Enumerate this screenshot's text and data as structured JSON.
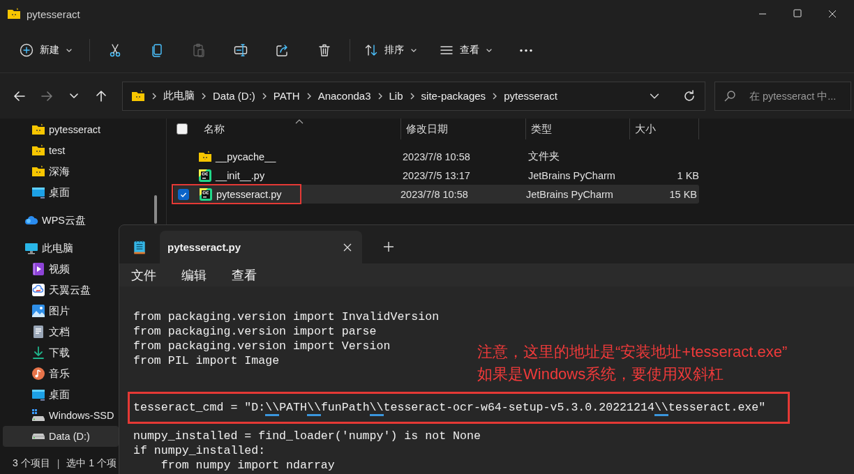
{
  "window": {
    "title": "pytesseract"
  },
  "toolbar": {
    "groups": [
      [
        {
          "kind": "new",
          "label": "新建",
          "disabled": false
        }
      ],
      [
        {
          "kind": "cut",
          "disabled": false
        },
        {
          "kind": "copy",
          "disabled": false
        },
        {
          "kind": "paste",
          "disabled": true
        },
        {
          "kind": "rename",
          "disabled": false
        },
        {
          "kind": "share",
          "disabled": false
        },
        {
          "kind": "delete",
          "disabled": false
        }
      ],
      [
        {
          "kind": "sort",
          "label": "排序",
          "disabled": false
        },
        {
          "kind": "view",
          "label": "查看",
          "disabled": false
        },
        {
          "kind": "more",
          "disabled": false
        }
      ]
    ]
  },
  "nav": [
    {
      "kind": "back",
      "disabled": false
    },
    {
      "kind": "forward",
      "disabled": true
    },
    {
      "kind": "recent",
      "disabled": false
    },
    {
      "kind": "up",
      "disabled": false
    }
  ],
  "address": {
    "crumbs": [
      "此电脑",
      "Data (D:)",
      "PATH",
      "Anaconda3",
      "Lib",
      "site-packages",
      "pytesseract"
    ]
  },
  "search": {
    "placeholder": "在 pytesseract 中..."
  },
  "sidebar": {
    "pinned": [
      {
        "label": "pytesseract",
        "kind": "folder",
        "selected": false
      },
      {
        "label": "test",
        "kind": "folder",
        "selected": false
      },
      {
        "label": "深海",
        "kind": "folder",
        "selected": false
      },
      {
        "label": "桌面",
        "kind": "desktop",
        "selected": false
      }
    ],
    "items": [
      {
        "label": "WPS云盘",
        "kind": "cloud",
        "selected": false
      },
      {
        "label": "此电脑",
        "kind": "computer",
        "selected": false,
        "children": [
          {
            "label": "视频",
            "kind": "video",
            "selected": false
          },
          {
            "label": "天翼云盘",
            "kind": "cloud-drive",
            "selected": false
          },
          {
            "label": "图片",
            "kind": "pictures",
            "selected": false
          },
          {
            "label": "文档",
            "kind": "documents",
            "selected": false
          },
          {
            "label": "下载",
            "kind": "download",
            "selected": false
          },
          {
            "label": "音乐",
            "kind": "music",
            "selected": false
          },
          {
            "label": "桌面",
            "kind": "desktop",
            "selected": false
          },
          {
            "label": "Windows-SSD",
            "kind": "drive-windows",
            "selected": false
          },
          {
            "label": "Data (D:)",
            "kind": "drive",
            "selected": true
          }
        ]
      }
    ]
  },
  "file_list": {
    "select_all": {
      "checked": false
    },
    "columns": [
      {
        "label": "名称",
        "sorted": true
      },
      {
        "label": "修改日期",
        "sorted": false
      },
      {
        "label": "类型",
        "sorted": false
      },
      {
        "label": "大小",
        "sorted": false
      }
    ],
    "rows": [
      {
        "name": "__pycache__",
        "kind": "folder",
        "date": "2023/7/8 10:58",
        "type": "文件夹",
        "selected": false,
        "checked": false,
        "annotated": false
      },
      {
        "name": "__init__.py",
        "kind": "python",
        "date": "2023/7/5 13:17",
        "type": "JetBrains PyCharm",
        "size": "1 KB",
        "selected": false,
        "checked": false,
        "annotated": false
      },
      {
        "name": "pytesseract.py",
        "kind": "python",
        "date": "2023/7/8 10:58",
        "type": "JetBrains PyCharm",
        "size": "15 KB",
        "selected": true,
        "checked": true,
        "annotated": true
      }
    ]
  },
  "status_bar": {
    "count": "3 个项目",
    "separator": "|",
    "selection": "选中 1 个项"
  },
  "notepad": {
    "tab": {
      "title": "pytesseract.py",
      "selected": true
    },
    "menu": [
      "文件",
      "编辑",
      "查看"
    ],
    "lines": [
      {
        "space_before": false,
        "boxed": false,
        "segments": [
          {
            "text": "from packaging.version import InvalidVersion"
          }
        ]
      },
      {
        "space_before": false,
        "boxed": false,
        "segments": [
          {
            "text": "from packaging.version import parse"
          }
        ]
      },
      {
        "space_before": false,
        "boxed": false,
        "segments": [
          {
            "text": "from packaging.version import Version"
          }
        ]
      },
      {
        "space_before": false,
        "boxed": false,
        "segments": [
          {
            "text": "from PIL import Image"
          }
        ]
      },
      {
        "space_before": true,
        "boxed": true,
        "segments": [
          {
            "text": "tesseract_cmd = \"D:"
          },
          {
            "text": "\\\\",
            "marked": true
          },
          {
            "text": "PATH"
          },
          {
            "text": "\\\\",
            "marked": true
          },
          {
            "text": "funPath"
          },
          {
            "text": "\\\\",
            "marked": true
          },
          {
            "text": "tesseract-ocr-w64-setup-v5.3.0.20221214"
          },
          {
            "text": "\\\\",
            "marked": true
          },
          {
            "text": "tesseract.exe\""
          }
        ]
      },
      {
        "space_before": false,
        "boxed": false,
        "segments": [
          {
            "text": "numpy_installed = find_loader('numpy') is not None"
          }
        ]
      },
      {
        "space_before": false,
        "boxed": false,
        "segments": [
          {
            "text": "if numpy_installed:"
          }
        ]
      },
      {
        "space_before": false,
        "boxed": false,
        "segments": [
          {
            "text": "    from numpy import ndarray"
          }
        ]
      }
    ],
    "annotations": [
      "注意，这里的地址是“安装地址+tesseract.exe”",
      "如果是Windows系统，要使用双斜杠"
    ]
  }
}
